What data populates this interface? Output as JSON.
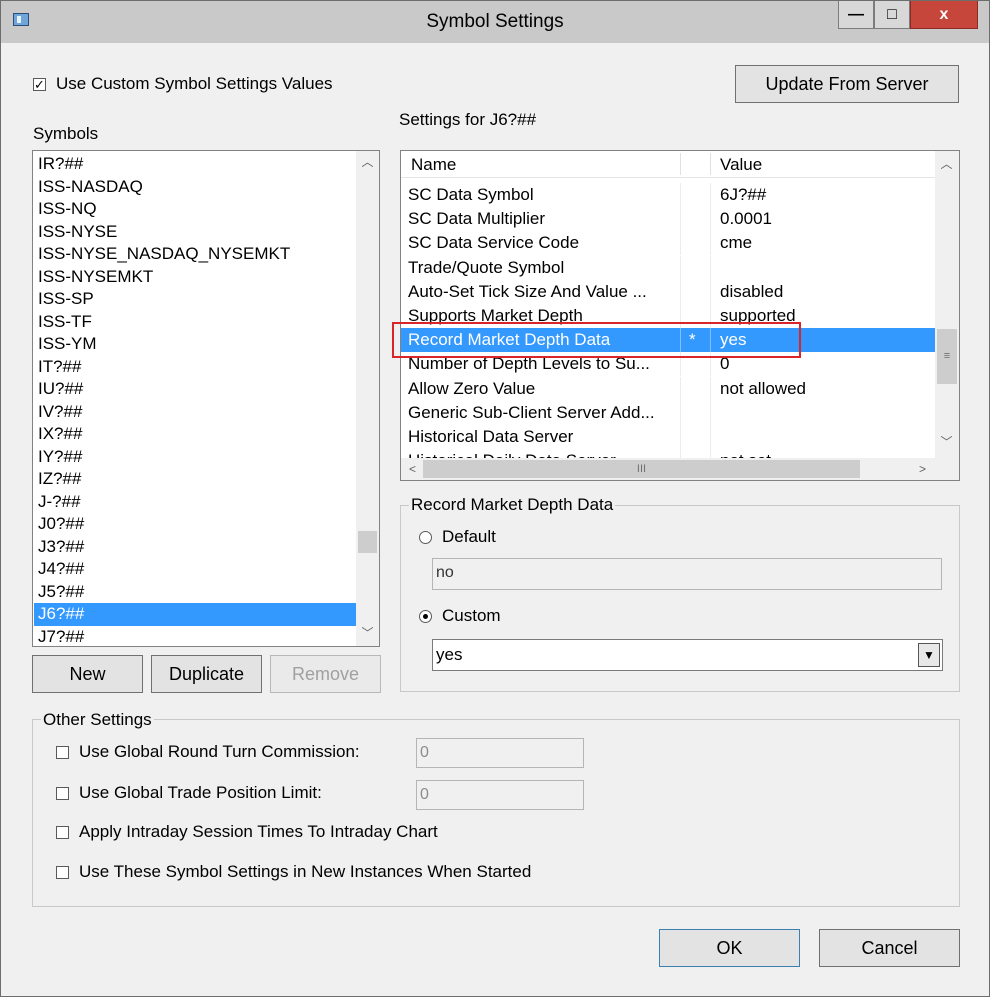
{
  "window": {
    "title": "Symbol Settings",
    "minimize": "—",
    "maximize": "□",
    "close": "x"
  },
  "use_custom": {
    "label": "Use Custom Symbol Settings Values",
    "checked": true
  },
  "update_button": "Update From Server",
  "symbols": {
    "label": "Symbols",
    "items": [
      "IR?##",
      "ISS-NASDAQ",
      "ISS-NQ",
      "ISS-NYSE",
      "ISS-NYSE_NASDAQ_NYSEMKT",
      "ISS-NYSEMKT",
      "ISS-SP",
      "ISS-TF",
      "ISS-YM",
      "IT?##",
      "IU?##",
      "IV?##",
      "IX?##",
      "IY?##",
      "IZ?##",
      "J-?##",
      "J0?##",
      "J3?##",
      "J4?##",
      "J5?##",
      "J6?##",
      "J7?##"
    ],
    "selected": "J6?##",
    "buttons": {
      "new": "New",
      "duplicate": "Duplicate",
      "remove": "Remove"
    }
  },
  "settings": {
    "label": "Settings for J6?##",
    "columns": {
      "name": "Name",
      "value": "Value"
    },
    "rows": [
      {
        "name": "SC Data Symbol",
        "flag": "",
        "value": "6J?##"
      },
      {
        "name": "SC Data Multiplier",
        "flag": "",
        "value": "0.0001"
      },
      {
        "name": "SC Data Service Code",
        "flag": "",
        "value": "cme"
      },
      {
        "name": "Trade/Quote Symbol",
        "flag": "",
        "value": ""
      },
      {
        "name": "Auto-Set Tick Size And Value ...",
        "flag": "",
        "value": "disabled"
      },
      {
        "name": "Supports Market Depth",
        "flag": "",
        "value": "supported"
      },
      {
        "name": "Record Market Depth Data",
        "flag": "*",
        "value": "yes"
      },
      {
        "name": "Number of Depth Levels to Su...",
        "flag": "",
        "value": "0"
      },
      {
        "name": "Allow Zero Value",
        "flag": "",
        "value": "not allowed"
      },
      {
        "name": "Generic Sub-Client Server Add...",
        "flag": "",
        "value": ""
      },
      {
        "name": "Historical Data Server",
        "flag": "",
        "value": ""
      },
      {
        "name": "Historical Daily Data Server",
        "flag": "",
        "value": "not set"
      }
    ],
    "selected_row": "Record Market Depth Data",
    "hscroll_grip": "III"
  },
  "detail": {
    "group_label": "Record Market Depth Data",
    "default_label": "Default",
    "default_value": "no",
    "custom_label": "Custom",
    "custom_value": "yes",
    "selected_option": "Custom"
  },
  "other": {
    "group_label": "Other Settings",
    "round_turn": {
      "label": "Use Global Round Turn Commission:",
      "value": "0",
      "checked": false
    },
    "position_limit": {
      "label": "Use Global Trade Position Limit:",
      "value": "0",
      "checked": false
    },
    "intraday": {
      "label": "Apply Intraday Session Times To Intraday Chart",
      "checked": false
    },
    "new_instances": {
      "label": "Use These Symbol Settings in New Instances When Started",
      "checked": false
    }
  },
  "footer": {
    "ok": "OK",
    "cancel": "Cancel"
  },
  "colors": {
    "selection": "#3399ff",
    "highlight_box": "#d9252a"
  }
}
